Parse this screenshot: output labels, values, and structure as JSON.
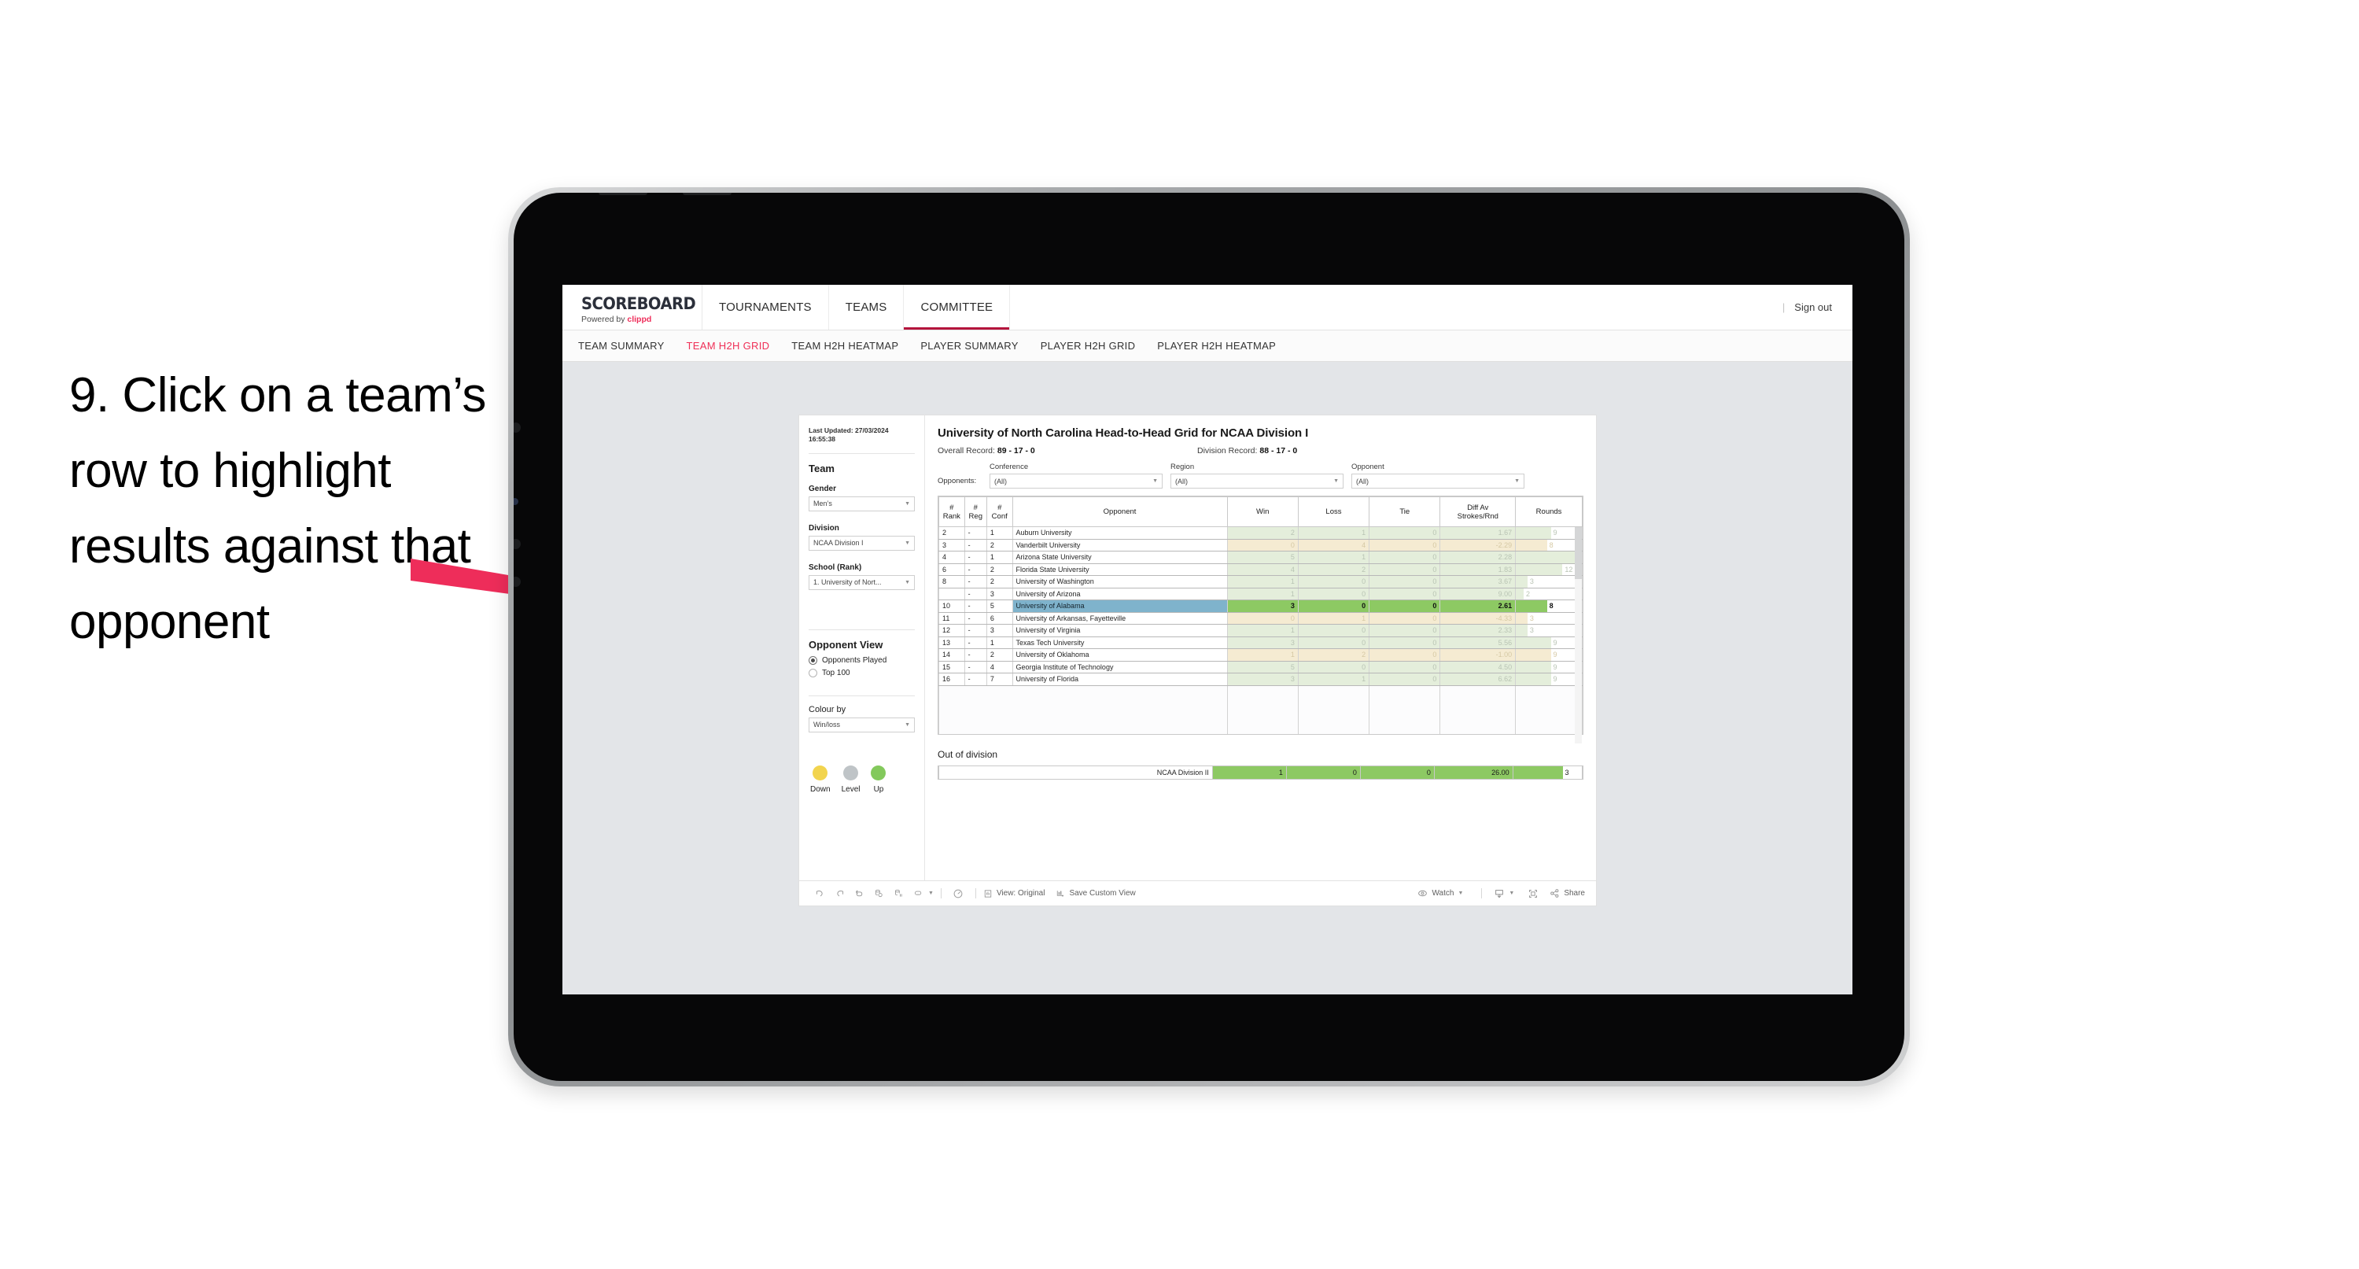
{
  "instruction": {
    "text": "9. Click on a team’s row to highlight results against that opponent"
  },
  "app": {
    "brand_title": "SCOREBOARD",
    "brand_powered_prefix": "Powered by ",
    "brand_powered_name": "clippd",
    "topnav": [
      {
        "label": "TOURNAMENTS",
        "active": false
      },
      {
        "label": "TEAMS",
        "active": false
      },
      {
        "label": "COMMITTEE",
        "active": true
      }
    ],
    "signout_separator": "|",
    "signout_label": "Sign out",
    "subnav": [
      {
        "label": "TEAM SUMMARY",
        "active": false
      },
      {
        "label": "TEAM H2H GRID",
        "active": true
      },
      {
        "label": "TEAM H2H HEATMAP",
        "active": false
      },
      {
        "label": "PLAYER SUMMARY",
        "active": false
      },
      {
        "label": "PLAYER H2H GRID",
        "active": false
      },
      {
        "label": "PLAYER H2H HEATMAP",
        "active": false
      }
    ]
  },
  "filters": {
    "last_updated": "Last Updated: 27/03/2024 16:55:38",
    "team_title": "Team",
    "gender": {
      "label": "Gender",
      "value": "Men’s"
    },
    "division": {
      "label": "Division",
      "value": "NCAA Division I"
    },
    "school": {
      "label": "School (Rank)",
      "value": "1. University of Nort..."
    },
    "opponent_view": {
      "title": "Opponent View",
      "options": [
        {
          "label": "Opponents Played",
          "selected": true
        },
        {
          "label": "Top 100",
          "selected": false
        }
      ]
    },
    "colour_by": {
      "label": "Colour by",
      "value": "Win/loss"
    },
    "legend": [
      {
        "label": "Down",
        "color": "#f2d44e"
      },
      {
        "label": "Level",
        "color": "#bfc4c7"
      },
      {
        "label": "Up",
        "color": "#83c95c"
      }
    ]
  },
  "viz": {
    "title": "University of North Carolina Head-to-Head Grid for NCAA Division I",
    "overall_record_label": "Overall Record: ",
    "overall_record_value": "89 - 17 - 0",
    "division_record_label": "Division Record: ",
    "division_record_value": "88 - 17 - 0",
    "opponents_label": "Opponents:",
    "opponent_filters": [
      {
        "label": "Conference",
        "value": "(All)"
      },
      {
        "label": "Region",
        "value": "(All)"
      },
      {
        "label": "Opponent",
        "value": "(All)"
      }
    ]
  },
  "chart_data": {
    "type": "table",
    "title": "University of North Carolina Head-to-Head Grid for NCAA Division I",
    "columns": [
      "# Rank",
      "# Reg",
      "# Conf",
      "Opponent",
      "Win",
      "Loss",
      "Tie",
      "Diff Av Strokes/Rnd",
      "Rounds"
    ],
    "rounds_max": 17,
    "rows": [
      {
        "rank": "2",
        "reg": "-",
        "conf": "1",
        "opponent": "Auburn University",
        "win": "2",
        "loss": "1",
        "tie": "0",
        "diff": "1.67",
        "rounds": "9",
        "state": "up",
        "selected": false
      },
      {
        "rank": "3",
        "reg": "-",
        "conf": "2",
        "opponent": "Vanderbilt University",
        "win": "0",
        "loss": "4",
        "tie": "0",
        "diff": "-2.29",
        "rounds": "8",
        "state": "down",
        "selected": false
      },
      {
        "rank": "4",
        "reg": "-",
        "conf": "1",
        "opponent": "Arizona State University",
        "win": "5",
        "loss": "1",
        "tie": "0",
        "diff": "2.28",
        "rounds": "17",
        "state": "up",
        "selected": false
      },
      {
        "rank": "6",
        "reg": "-",
        "conf": "2",
        "opponent": "Florida State University",
        "win": "4",
        "loss": "2",
        "tie": "0",
        "diff": "1.83",
        "rounds": "12",
        "state": "up",
        "selected": false
      },
      {
        "rank": "8",
        "reg": "-",
        "conf": "2",
        "opponent": "University of Washington",
        "win": "1",
        "loss": "0",
        "tie": "0",
        "diff": "3.67",
        "rounds": "3",
        "state": "up",
        "selected": false
      },
      {
        "rank": "",
        "reg": "-",
        "conf": "3",
        "opponent": "University of Arizona",
        "win": "1",
        "loss": "0",
        "tie": "0",
        "diff": "9.00",
        "rounds": "2",
        "state": "up",
        "selected": false
      },
      {
        "rank": "10",
        "reg": "-",
        "conf": "5",
        "opponent": "University of Alabama",
        "win": "3",
        "loss": "0",
        "tie": "0",
        "diff": "2.61",
        "rounds": "8",
        "state": "up",
        "selected": true
      },
      {
        "rank": "11",
        "reg": "-",
        "conf": "6",
        "opponent": "University of Arkansas, Fayetteville",
        "win": "0",
        "loss": "1",
        "tie": "0",
        "diff": "-4.33",
        "rounds": "3",
        "state": "down",
        "selected": false
      },
      {
        "rank": "12",
        "reg": "-",
        "conf": "3",
        "opponent": "University of Virginia",
        "win": "1",
        "loss": "0",
        "tie": "0",
        "diff": "2.33",
        "rounds": "3",
        "state": "up",
        "selected": false
      },
      {
        "rank": "13",
        "reg": "-",
        "conf": "1",
        "opponent": "Texas Tech University",
        "win": "3",
        "loss": "0",
        "tie": "0",
        "diff": "5.56",
        "rounds": "9",
        "state": "up",
        "selected": false
      },
      {
        "rank": "14",
        "reg": "-",
        "conf": "2",
        "opponent": "University of Oklahoma",
        "win": "1",
        "loss": "2",
        "tie": "0",
        "diff": "-1.00",
        "rounds": "9",
        "state": "down",
        "selected": false
      },
      {
        "rank": "15",
        "reg": "-",
        "conf": "4",
        "opponent": "Georgia Institute of Technology",
        "win": "5",
        "loss": "0",
        "tie": "0",
        "diff": "4.50",
        "rounds": "9",
        "state": "up",
        "selected": false
      },
      {
        "rank": "16",
        "reg": "-",
        "conf": "7",
        "opponent": "University of Florida",
        "win": "3",
        "loss": "1",
        "tie": "0",
        "diff": "6.62",
        "rounds": "9",
        "state": "up",
        "selected": false
      }
    ],
    "out_of_division": {
      "title": "Out of division",
      "label": "NCAA Division II",
      "win": "1",
      "loss": "0",
      "tie": "0",
      "diff": "26.00",
      "rounds": "3"
    },
    "colors": {
      "up_faint": "#e4eedb",
      "down_faint": "#f5ebd2",
      "up_strong": "#8dc963",
      "selected_name": "#7fb3cc"
    }
  },
  "toolbar": {
    "view_label": "View: Original",
    "save_label": "Save Custom View",
    "watch_label": "Watch",
    "share_label": "Share"
  }
}
